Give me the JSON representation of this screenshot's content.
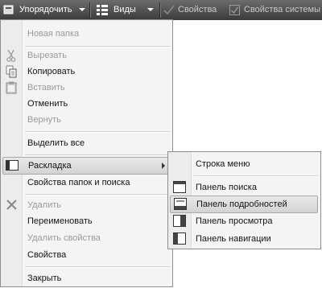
{
  "toolbar": {
    "organize_label": "Упорядочить",
    "views_label": "Виды",
    "properties_label": "Свойства",
    "system_properties_label": "Свойства системы"
  },
  "menu": {
    "items": [
      {
        "label": "Новая папка",
        "enabled": false,
        "icon": "none"
      },
      {
        "label": "Вырезать",
        "enabled": false,
        "icon": "scissors-icon"
      },
      {
        "label": "Копировать",
        "enabled": true,
        "icon": "copy-icon"
      },
      {
        "label": "Вставить",
        "enabled": false,
        "icon": "clipboard-icon"
      },
      {
        "label": "Отменить",
        "enabled": true,
        "icon": "none"
      },
      {
        "label": "Вернуть",
        "enabled": false,
        "icon": "none"
      },
      {
        "label": "Выделить все",
        "enabled": true,
        "icon": "none"
      },
      {
        "label": "Раскладка",
        "enabled": true,
        "icon": "layout-icon",
        "highlighted": true,
        "has_submenu": true
      },
      {
        "label": "Свойства папок и поиска",
        "enabled": true,
        "icon": "none"
      },
      {
        "label": "Удалить",
        "enabled": false,
        "icon": "delete-x-icon"
      },
      {
        "label": "Переименовать",
        "enabled": true,
        "icon": "none"
      },
      {
        "label": "Удалить свойства",
        "enabled": false,
        "icon": "none"
      },
      {
        "label": "Свойства",
        "enabled": true,
        "icon": "none"
      },
      {
        "label": "Закрыть",
        "enabled": true,
        "icon": "none"
      }
    ]
  },
  "submenu": {
    "items": [
      {
        "label": "Строка меню",
        "icon": "none"
      },
      {
        "label": "Панель поиска",
        "icon": "search-pane-icon"
      },
      {
        "label": "Панель подробностей",
        "icon": "details-pane-icon",
        "highlighted": true
      },
      {
        "label": "Панель просмотра",
        "icon": "preview-pane-icon"
      },
      {
        "label": "Панель навигации",
        "icon": "navigation-pane-icon"
      }
    ]
  }
}
